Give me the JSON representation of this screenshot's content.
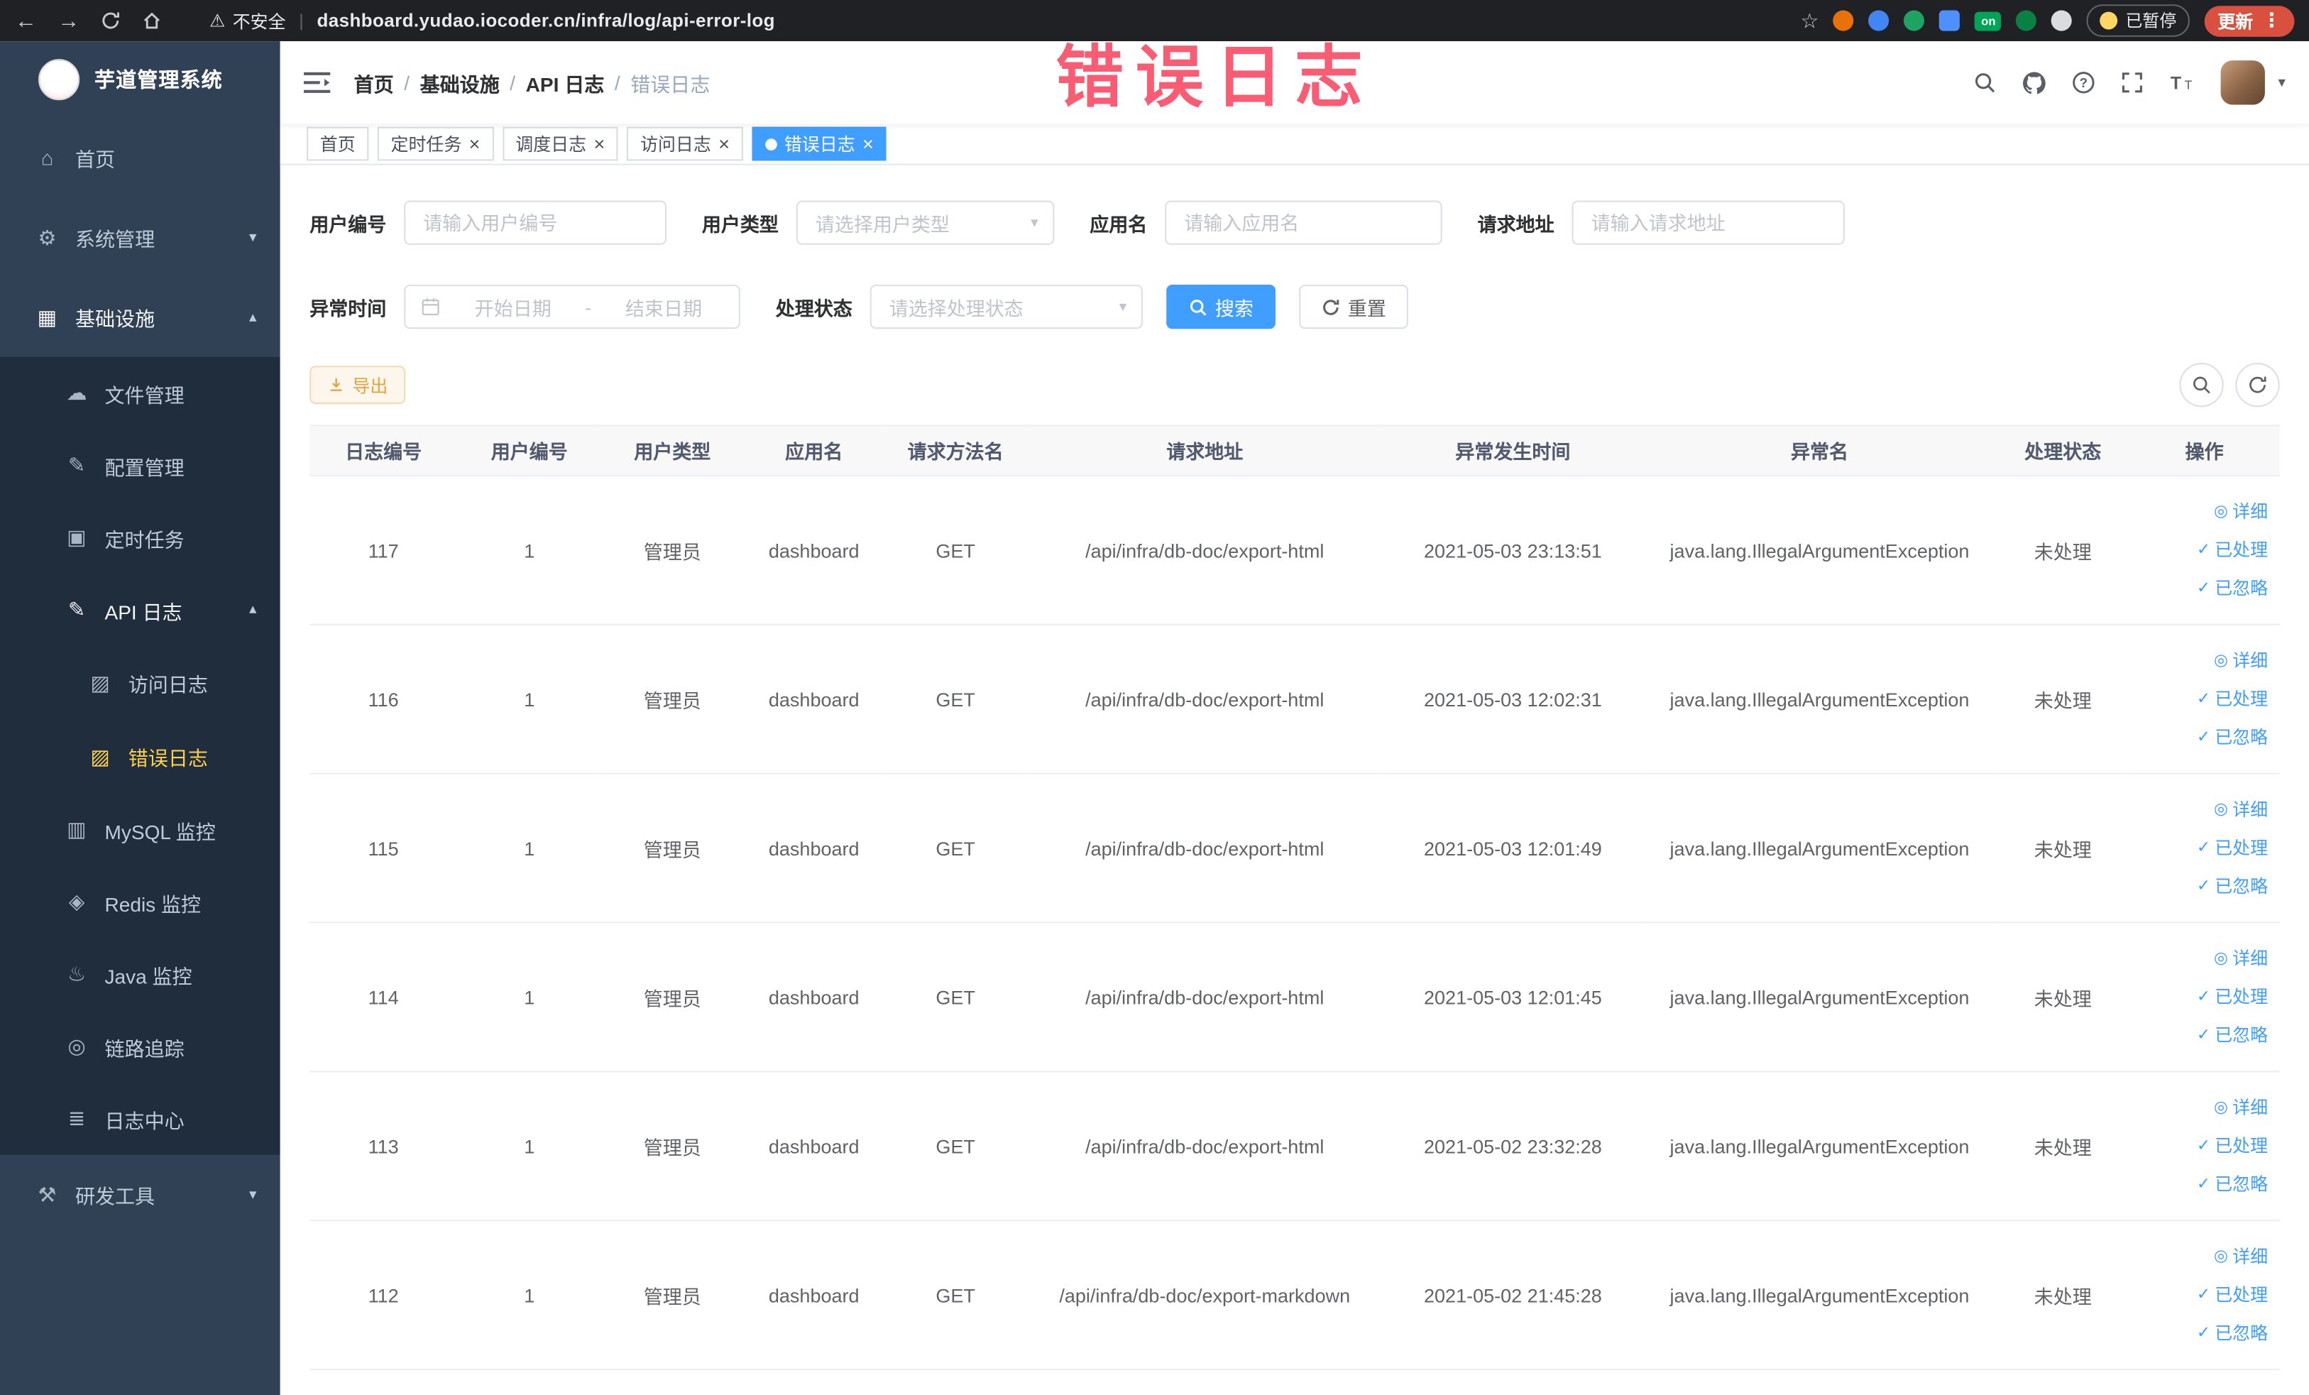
{
  "browser": {
    "security_label": "不安全",
    "url": "dashboard.yudao.iocoder.cn/infra/log/api-error-log",
    "on_badge": "on",
    "paused_badge": "已暂停",
    "update_label": "更新"
  },
  "annotation": {
    "text": "错误日志"
  },
  "sidebar": {
    "logo_title": "芋道管理系统",
    "menu": [
      {
        "key": "home",
        "label": "首页",
        "icon": "home-icon",
        "level": 0
      },
      {
        "key": "system-management",
        "label": "系统管理",
        "icon": "gear-icon",
        "level": 0,
        "arrow": "down"
      },
      {
        "key": "infrastructure",
        "label": "基础设施",
        "icon": "infra-icon",
        "level": 0,
        "arrow": "up",
        "open": true
      },
      {
        "key": "file-management",
        "label": "文件管理",
        "icon": "file-icon",
        "level": 1,
        "sub": true
      },
      {
        "key": "config-management",
        "label": "配置管理",
        "icon": "config-icon",
        "level": 1,
        "sub": true
      },
      {
        "key": "scheduled-task",
        "label": "定时任务",
        "icon": "task-icon",
        "level": 1,
        "sub": true
      },
      {
        "key": "api-log",
        "label": "API 日志",
        "icon": "api-log-icon",
        "level": 1,
        "sub": true,
        "arrow": "up",
        "open": true
      },
      {
        "key": "access-log",
        "label": "访问日志",
        "icon": "access-log-icon",
        "level": 2,
        "sub": true
      },
      {
        "key": "error-log",
        "label": "错误日志",
        "icon": "error-log-icon",
        "level": 2,
        "sub": true,
        "active": true
      },
      {
        "key": "mysql-monitor",
        "label": "MySQL 监控",
        "icon": "mysql-icon",
        "level": 1,
        "sub": true
      },
      {
        "key": "redis-monitor",
        "label": "Redis 监控",
        "icon": "redis-icon",
        "level": 1,
        "sub": true
      },
      {
        "key": "java-monitor",
        "label": "Java 监控",
        "icon": "java-icon",
        "level": 1,
        "sub": true
      },
      {
        "key": "link-trace",
        "label": "链路追踪",
        "icon": "trace-icon",
        "level": 1,
        "sub": true
      },
      {
        "key": "log-center",
        "label": "日志中心",
        "icon": "log-center-icon",
        "level": 1,
        "sub": true
      },
      {
        "key": "dev-tools",
        "label": "研发工具",
        "icon": "devtools-icon",
        "level": 0,
        "arrow": "down"
      }
    ]
  },
  "header": {
    "breadcrumb": [
      "首页",
      "基础设施",
      "API 日志",
      "错误日志"
    ],
    "separator": "/"
  },
  "tabs": [
    {
      "key": "home",
      "label": "首页"
    },
    {
      "key": "scheduled-task",
      "label": "定时任务",
      "closable": true
    },
    {
      "key": "schedule-log",
      "label": "调度日志",
      "closable": true
    },
    {
      "key": "access-log",
      "label": "访问日志",
      "closable": true
    },
    {
      "key": "error-log",
      "label": "错误日志",
      "closable": true,
      "active": true
    }
  ],
  "filters": {
    "user_id": {
      "label": "用户编号",
      "placeholder": "请输入用户编号"
    },
    "user_type": {
      "label": "用户类型",
      "placeholder": "请选择用户类型"
    },
    "app_name": {
      "label": "应用名",
      "placeholder": "请输入应用名"
    },
    "request_url": {
      "label": "请求地址",
      "placeholder": "请输入请求地址"
    },
    "exception_time": {
      "label": "异常时间",
      "start_placeholder": "开始日期",
      "separator": "-",
      "end_placeholder": "结束日期"
    },
    "process_status": {
      "label": "处理状态",
      "placeholder": "请选择处理状态"
    },
    "search_label": "搜索",
    "reset_label": "重置"
  },
  "toolbar": {
    "export_label": "导出"
  },
  "table": {
    "columns": [
      "日志编号",
      "用户编号",
      "用户类型",
      "应用名",
      "请求方法名",
      "请求地址",
      "异常发生时间",
      "异常名",
      "处理状态",
      "操作"
    ],
    "actions": [
      {
        "key": "detail",
        "label": "详细",
        "icon": "eye-icon"
      },
      {
        "key": "processed",
        "label": "已处理",
        "icon": "check-icon"
      },
      {
        "key": "ignore",
        "label": "已忽略",
        "icon": "check-icon"
      }
    ],
    "rows": [
      {
        "log_id": "117",
        "user_id": "1",
        "user_type": "管理员",
        "app_name": "dashboard",
        "method": "GET",
        "request_url": "/api/infra/db-doc/export-html",
        "time": "2021-05-03 23:13:51",
        "exception": "java.lang.IllegalArgumentException",
        "status": "未处理"
      },
      {
        "log_id": "116",
        "user_id": "1",
        "user_type": "管理员",
        "app_name": "dashboard",
        "method": "GET",
        "request_url": "/api/infra/db-doc/export-html",
        "time": "2021-05-03 12:02:31",
        "exception": "java.lang.IllegalArgumentException",
        "status": "未处理"
      },
      {
        "log_id": "115",
        "user_id": "1",
        "user_type": "管理员",
        "app_name": "dashboard",
        "method": "GET",
        "request_url": "/api/infra/db-doc/export-html",
        "time": "2021-05-03 12:01:49",
        "exception": "java.lang.IllegalArgumentException",
        "status": "未处理"
      },
      {
        "log_id": "114",
        "user_id": "1",
        "user_type": "管理员",
        "app_name": "dashboard",
        "method": "GET",
        "request_url": "/api/infra/db-doc/export-html",
        "time": "2021-05-03 12:01:45",
        "exception": "java.lang.IllegalArgumentException",
        "status": "未处理"
      },
      {
        "log_id": "113",
        "user_id": "1",
        "user_type": "管理员",
        "app_name": "dashboard",
        "method": "GET",
        "request_url": "/api/infra/db-doc/export-html",
        "time": "2021-05-02 23:32:28",
        "exception": "java.lang.IllegalArgumentException",
        "status": "未处理"
      },
      {
        "log_id": "112",
        "user_id": "1",
        "user_type": "管理员",
        "app_name": "dashboard",
        "method": "GET",
        "request_url": "/api/infra/db-doc/export-markdown",
        "time": "2021-05-02 21:45:28",
        "exception": "java.lang.IllegalArgumentException",
        "status": "未处理"
      }
    ]
  }
}
